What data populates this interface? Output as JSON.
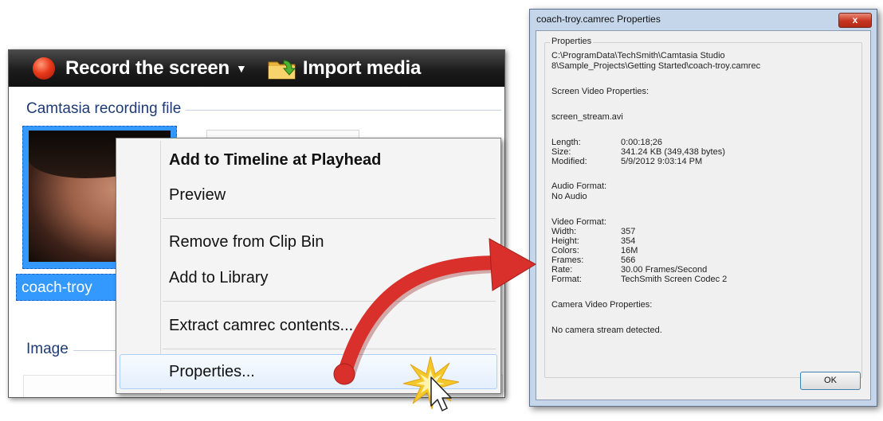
{
  "toolbar": {
    "record_label": "Record the screen",
    "record_caret": "▼",
    "import_label": "Import media"
  },
  "clip_bin": {
    "section_recording": "Camtasia recording file",
    "clip_name": "coach-troy",
    "section_image": "Image"
  },
  "context_menu": {
    "items": [
      {
        "label": "Add to Timeline at Playhead"
      },
      {
        "label": "Preview"
      },
      {
        "label": "Remove from Clip Bin"
      },
      {
        "label": "Add to Library"
      },
      {
        "label": "Extract camrec contents..."
      },
      {
        "label": "Properties..."
      }
    ]
  },
  "dialog": {
    "title": "coach-troy.camrec Properties",
    "close_label": "x",
    "group_label": "Properties",
    "path_line1": "C:\\ProgramData\\TechSmith\\Camtasia Studio",
    "path_line2": "8\\Sample_Projects\\Getting Started\\coach-troy.camrec",
    "screen_video_heading": "Screen Video Properties:",
    "stream_file": "screen_stream.avi",
    "length_label": "Length:",
    "length_value": "0:00:18;26",
    "size_label": "Size:",
    "size_value": "341.24 KB (349,438 bytes)",
    "modified_label": "Modified:",
    "modified_value": "5/9/2012 9:03:14 PM",
    "audio_heading": "Audio Format:",
    "audio_value": "No Audio",
    "video_heading": "Video Format:",
    "width_label": "Width:",
    "width_value": "357",
    "height_label": "Height:",
    "height_value": "354",
    "colors_label": "Colors:",
    "colors_value": "16M",
    "frames_label": "Frames:",
    "frames_value": "566",
    "rate_label": "Rate:",
    "rate_value": "30.00 Frames/Second",
    "format_label": "Format:",
    "format_value": "TechSmith Screen Codec 2",
    "camera_heading": "Camera Video Properties:",
    "camera_value": "No camera stream detected.",
    "ok_label": "OK"
  },
  "colors": {
    "selection": "#3399ff",
    "section_title": "#1e3b73",
    "callout_arrow": "#d9302b",
    "click_burst": "#f5c82a"
  },
  "icons": {
    "record": "record-dot-icon",
    "import": "folder-import-icon",
    "cursor": "mouse-pointer-icon",
    "burst": "click-burst-icon",
    "arrow": "curved-callout-arrow-icon"
  }
}
